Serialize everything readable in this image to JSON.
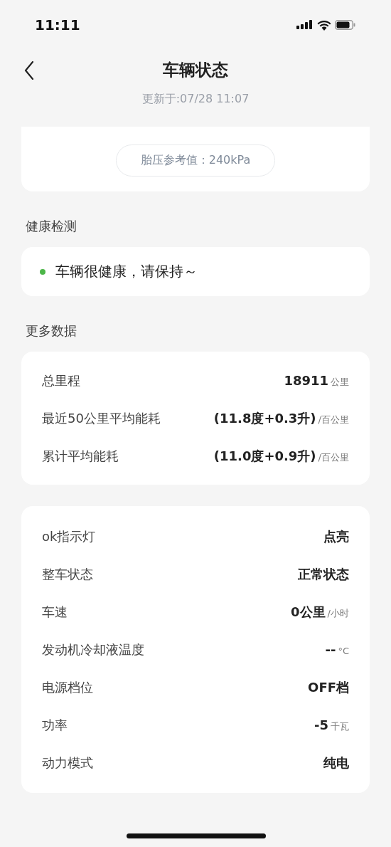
{
  "status_bar": {
    "time": "11:11"
  },
  "header": {
    "title": "车辆状态",
    "updated": "更新于:07/28 11:07"
  },
  "tire_card": {
    "reference": "胎压参考值：240kPa"
  },
  "health": {
    "heading": "健康检测",
    "status": {
      "text": "车辆很健康，请保持～",
      "color": "#4cb648"
    }
  },
  "more_data": {
    "heading": "更多数据",
    "rows": [
      {
        "label": "总里程",
        "value": "18911",
        "unit": "公里"
      },
      {
        "label": "最近50公里平均能耗",
        "value": "(11.8度+0.3升)",
        "unit": "/百公里"
      },
      {
        "label": "累计平均能耗",
        "value": "(11.0度+0.9升)",
        "unit": "/百公里"
      }
    ]
  },
  "vehicle": {
    "rows": [
      {
        "label": "ok指示灯",
        "value": "点亮"
      },
      {
        "label": "整车状态",
        "value": "正常状态"
      },
      {
        "label": "车速",
        "value": "0公里",
        "unit": "/小时"
      },
      {
        "label": "发动机冷却液温度",
        "value": "--",
        "unit": "°C"
      },
      {
        "label": "电源档位",
        "value": "OFF档"
      },
      {
        "label": "功率",
        "value": "-5",
        "unit": "千瓦"
      },
      {
        "label": "动力模式",
        "value": "纯电"
      }
    ]
  }
}
